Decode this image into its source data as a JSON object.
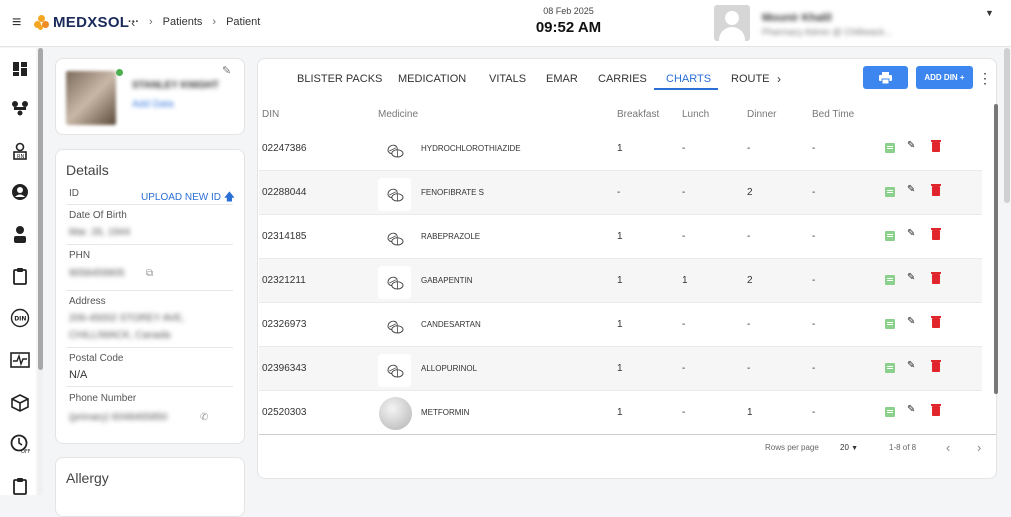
{
  "header": {
    "brand": "MEDXSOL",
    "collapse_icon": "collapse-menu-icon",
    "breadcrumbs": [
      "Patients",
      "Patient"
    ],
    "date": "08 Feb 2025",
    "time": "09:52 AM",
    "user": {
      "name": "Mounir Khalil",
      "role": "Pharmacy Admin @ Chilliwack..."
    }
  },
  "sidebar": {
    "icons": [
      "dashboard-icon",
      "pharmacy-icon",
      "nurse-icon",
      "account-icon",
      "doctor-icon",
      "clipboard-icon",
      "din-icon",
      "monitor-icon",
      "package-icon",
      "dose-off-icon",
      "clipboard-alt-icon"
    ]
  },
  "patient": {
    "name": "STANLEY KNIGHT",
    "link": "Add Data"
  },
  "details": {
    "title": "Details",
    "id_label": "ID",
    "upload_label": "UPLOAD NEW ID",
    "dob_label": "Date Of Birth",
    "dob_value": "Mar. 26, 1944",
    "phn_label": "PHN",
    "phn_value": "9058459905",
    "address_label": "Address",
    "address_line1": "206-45002 STOREY AVE,",
    "address_line2": "CHILLIWACK, Canada",
    "postal_label": "Postal Code",
    "postal_value": "N/A",
    "phone_label": "Phone Number",
    "phone_value": "(primary) 6048465850"
  },
  "allergy": {
    "title": "Allergy"
  },
  "tabs": [
    "BLISTER PACKS",
    "MEDICATION",
    "VITALS",
    "EMAR",
    "CARRIES",
    "CHARTS",
    "ROUTE"
  ],
  "active_tab": "CHARTS",
  "buttons": {
    "add_din": "ADD DIN +"
  },
  "table": {
    "headers": [
      "DIN",
      "Medicine",
      "Breakfast",
      "Lunch",
      "Dinner",
      "Bed Time"
    ],
    "rows": [
      {
        "din": "02247386",
        "medicine": "HYDROCHLOROTHIAZIDE",
        "breakfast": "1",
        "lunch": "-",
        "dinner": "-",
        "bedtime": "-"
      },
      {
        "din": "02288044",
        "medicine": "FENOFIBRATE S",
        "breakfast": "-",
        "lunch": "-",
        "dinner": "2",
        "bedtime": "-"
      },
      {
        "din": "02314185",
        "medicine": "RABEPRAZOLE",
        "breakfast": "1",
        "lunch": "-",
        "dinner": "-",
        "bedtime": "-"
      },
      {
        "din": "02321211",
        "medicine": "GABAPENTIN",
        "breakfast": "1",
        "lunch": "1",
        "dinner": "2",
        "bedtime": "-"
      },
      {
        "din": "02326973",
        "medicine": "CANDESARTAN",
        "breakfast": "1",
        "lunch": "-",
        "dinner": "-",
        "bedtime": "-"
      },
      {
        "din": "02396343",
        "medicine": "ALLOPURINOL",
        "breakfast": "1",
        "lunch": "-",
        "dinner": "-",
        "bedtime": "-"
      },
      {
        "din": "02520303",
        "medicine": "METFORMIN",
        "breakfast": "1",
        "lunch": "-",
        "dinner": "1",
        "bedtime": "-"
      }
    ]
  },
  "pagination": {
    "rows_per_page_label": "Rows per page",
    "rows_per_page": "20",
    "range": "1-8 of 8"
  },
  "colors": {
    "accent": "#3d86f0",
    "delete": "#e0262c",
    "note": "#8bd08b"
  }
}
